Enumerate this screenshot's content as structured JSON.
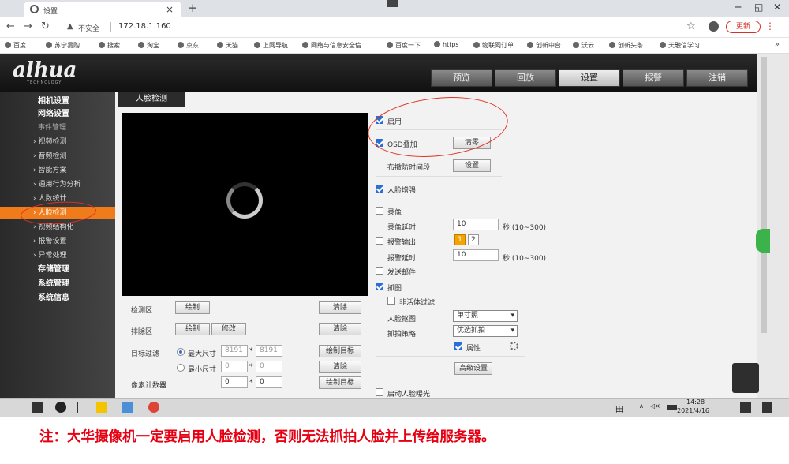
{
  "browser": {
    "tab_title": "设置",
    "tab_close": "×",
    "new_tab": "+",
    "insecure_label": "不安全",
    "url": "172.18.1.160",
    "update_label": "更新",
    "menu_glyph": "⋮",
    "bookmarks": [
      "百度",
      "苏宁易购",
      "搜索",
      "淘宝",
      "京东",
      "天猫",
      "上网导航",
      "网络与信息安全信...",
      "百度一下",
      "https",
      "物联网订单",
      "创新中台",
      "沃云",
      "创新头条",
      "天融信学习"
    ],
    "bookmarks_more": "»"
  },
  "app": {
    "logo": "alhua",
    "logo_sub": "TECHNOLOGY",
    "main_tabs": [
      "预览",
      "回放",
      "设置",
      "报警",
      "注销"
    ],
    "active_tab": "设置",
    "sidebar": {
      "cat_camera": "相机设置",
      "cat_network": "网络设置",
      "group_event": "事件管理",
      "items": [
        "视频检测",
        "音频检测",
        "智能方案",
        "通用行为分析",
        "人数统计",
        "人脸检测",
        "视频结构化",
        "报警设置",
        "异常处理"
      ],
      "cat_storage": "存储管理",
      "cat_system": "系统管理",
      "cat_info": "系统信息"
    },
    "page_tab": "人脸检测",
    "left_form": {
      "detect_area_label": "检测区",
      "draw": "绘制",
      "clear": "清除",
      "exclude_area_label": "排除区",
      "modify": "修改",
      "target_filter_label": "目标过滤",
      "max_size_label": "最大尺寸",
      "max_w": "8191",
      "max_h": "8191",
      "draw_target": "绘制目标",
      "min_size_label": "最小尺寸",
      "min_w": "0",
      "min_h": "0",
      "pixel_counter_label": "像素计数器",
      "pix_w": "0",
      "pix_h": "0",
      "star": "*"
    },
    "right_form": {
      "enable": "启用",
      "osd": "OSD叠加",
      "clear": "清零",
      "schedule": "布撤防时间段",
      "setup": "设置",
      "face_enhance": "人脸增强",
      "record": "录像",
      "record_delay": "录像延时",
      "record_delay_value": "10",
      "range_hint": "秒 (10~300)",
      "alarm_out": "报警输出",
      "ch1": "1",
      "ch2": "2",
      "alarm_delay": "报警延时",
      "alarm_delay_value": "10",
      "send_email": "发送邮件",
      "snapshot": "抓图",
      "non_living": "非活体过滤",
      "face_snapshot": "人脸抠图",
      "face_snapshot_value": "单寸照",
      "snap_strategy": "抓拍策略",
      "snap_strategy_value": "优选抓拍",
      "attribute": "属性",
      "advanced": "高级设置",
      "auto_exposure": "启动人脸曝光"
    }
  },
  "taskbar": {
    "grid": "田",
    "chevron": "∧",
    "volume": "◁×",
    "time": "14:28",
    "date": "2021/4/16"
  },
  "note": "注：大华摄像机一定要启用人脸检测，否则无法抓拍人脸并上传给服务器。"
}
